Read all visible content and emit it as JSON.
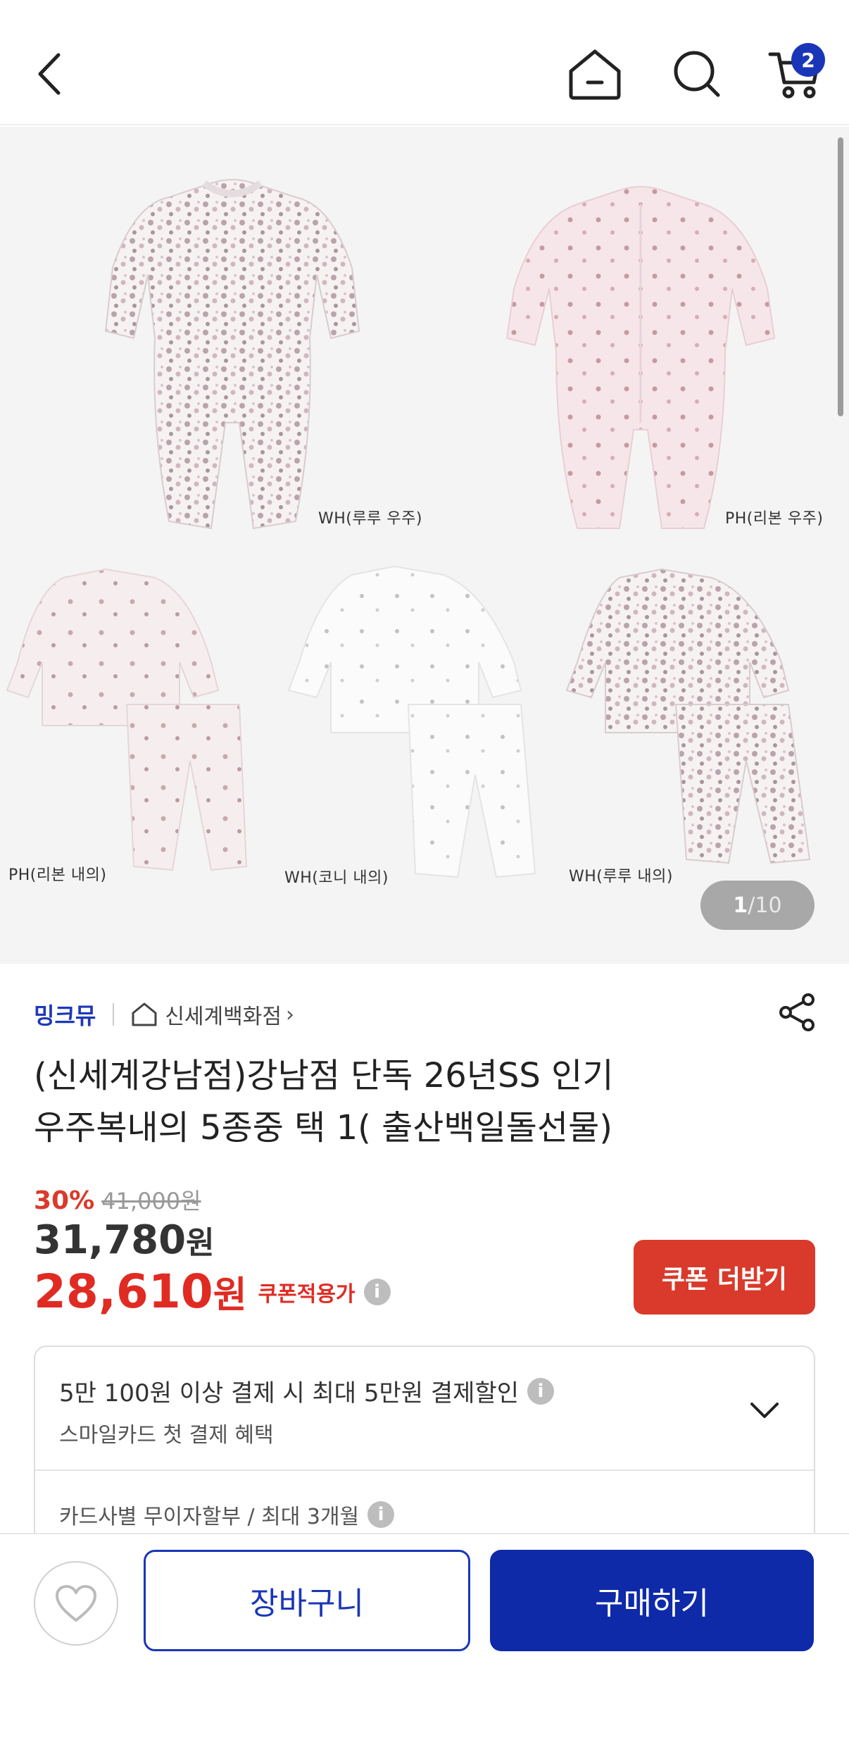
{
  "header": {
    "cart_count": "2"
  },
  "gallery": {
    "labels": [
      "WH(루루 우주)",
      "PH(리본 우주)",
      "PH(리본 내의)",
      "WH(코니 내의)",
      "WH(루루 내의)"
    ],
    "current_page": "1",
    "total_pages": "/10"
  },
  "product": {
    "brand": "밍크뮤",
    "store": "신세계백화점",
    "title_line1": "(신세계강남점)강남점 단독 26년SS 인기",
    "title_line2": "우주복내의 5종중 택 1( 출산백일돌선물)",
    "discount_pct": "30%",
    "original_price": "41,000원",
    "price": "31,780",
    "price_unit": "원",
    "coupon_price": "28,610",
    "coupon_unit": "원",
    "coupon_label": "쿠폰적용가",
    "coupon_button": "쿠폰 더받기"
  },
  "benefits": {
    "main": "5만 100원 이상 결제 시 최대 5만원 결제할인",
    "sub": "스마일카드 첫 결제 혜택",
    "installment": "카드사별 무이자할부 / 최대 3개월"
  },
  "bottom": {
    "cart_label": "장바구니",
    "buy_label": "구매하기"
  },
  "colors": {
    "accent_blue": "#1a36b8",
    "sale_red": "#e02b23"
  }
}
